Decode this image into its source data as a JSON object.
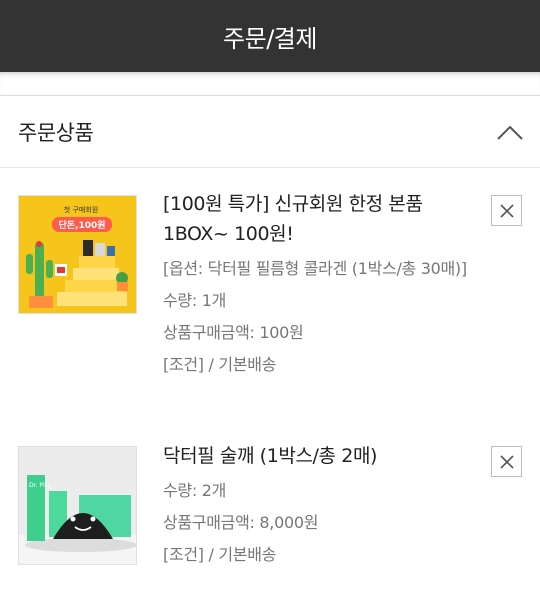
{
  "header": {
    "title": "주문/결제"
  },
  "section": {
    "title": "주문상품",
    "toggle_icon": "chevron-up-icon"
  },
  "thumb1": {
    "badge_line1": "첫 구매회원",
    "badge_line2": "단돈,100원",
    "brand": "Dr. PILL"
  },
  "thumb2": {
    "brand": "Dr. PILL"
  },
  "items": [
    {
      "title": "[100원 특가] 신규회원 한정 본품 1BOX~ 100원!",
      "option": "[옵션: 닥터필 필름형 콜라겐 (1박스/총 30매)]",
      "quantity": "수량: 1개",
      "price": "상품구매금액: 100원",
      "shipping": "[조건] / 기본배송",
      "remove_icon": "close-icon"
    },
    {
      "title": "닥터필 술깨 (1박스/총 2매)",
      "quantity": "수량: 2개",
      "price": "상품구매금액: 8,000원",
      "shipping": "[조건] / 기본배송",
      "remove_icon": "close-icon"
    }
  ],
  "colors": {
    "header_bg": "#333333",
    "thumb1_bg": "#f6c51b",
    "thumb2_bg": "#e9e9e9"
  }
}
